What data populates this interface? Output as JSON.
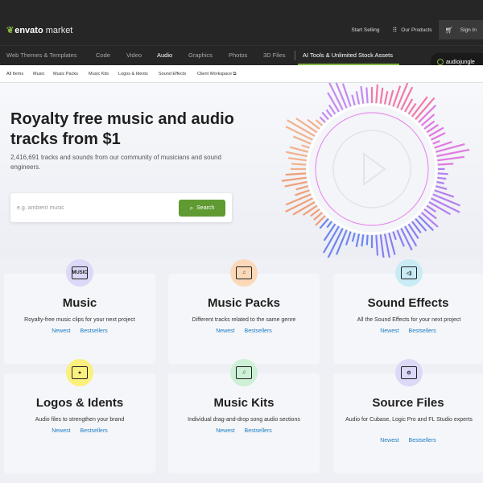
{
  "header": {
    "logo_brand": "envato",
    "logo_market": "market",
    "start_selling": "Start Selling",
    "our_products": "Our Products",
    "sign_in": "Sign In"
  },
  "nav": {
    "items": [
      "Web Themes & Templates",
      "Code",
      "Video",
      "Audio",
      "Graphics",
      "Photos",
      "3D Files"
    ],
    "active": "Audio",
    "ai_link": "AI Tools & Unlimited Stock Assets",
    "badge": "audiojungle"
  },
  "subnav": {
    "items": [
      "All Items",
      "Music",
      "Music Packs",
      "Music Kits",
      "Logos & Idents",
      "Sound Effects",
      "Client Workspace"
    ]
  },
  "hero": {
    "title": "Royalty free music and audio tracks from $1",
    "subtitle": "2,416,691 tracks and sounds from our community of musicians and sound engineers.",
    "search_placeholder": "e.g. ambient music",
    "search_button": "Search"
  },
  "categories": [
    {
      "title": "Music",
      "desc": "Royalty-free music clips for your next project",
      "link1": "Newest",
      "link2": "Bestsellers",
      "icon": "music-label-icon",
      "icon_bg": "#dcd8f7",
      "icon_text": "MUSIC"
    },
    {
      "title": "Music Packs",
      "desc": "Different tracks related to the same genre",
      "link1": "Newest",
      "link2": "Bestsellers",
      "icon": "music-pack-icon",
      "icon_bg": "#fbd9b8",
      "icon_text": "♫"
    },
    {
      "title": "Sound Effects",
      "desc": "All the Sound Effects for your next project",
      "link1": "Newest",
      "link2": "Bestsellers",
      "icon": "speaker-icon",
      "icon_bg": "#c9ebf5",
      "icon_text": "◁)"
    },
    {
      "title": "Logos & Idents",
      "desc": "Audio files to strengthen your brand",
      "link1": "Newest",
      "link2": "Bestsellers",
      "icon": "sparkle-icon",
      "icon_bg": "#fbf07e",
      "icon_text": "✦"
    },
    {
      "title": "Music Kits",
      "desc": "Individual drag-and-drop song audio sections",
      "link1": "Newest",
      "link2": "Bestsellers",
      "icon": "music-kit-icon",
      "icon_bg": "#cdf0d6",
      "icon_text": "♫"
    },
    {
      "title": "Source Files",
      "desc": "Audio for Cubase, Logic Pro and FL Studio experts",
      "link1": "Newest",
      "link2": "Bestsellers",
      "icon": "source-file-icon",
      "icon_bg": "#dcd8f7",
      "icon_text": "⚙"
    }
  ],
  "colors": {
    "accent": "#82b541",
    "link": "#1c7cc2",
    "dark": "#262626"
  }
}
